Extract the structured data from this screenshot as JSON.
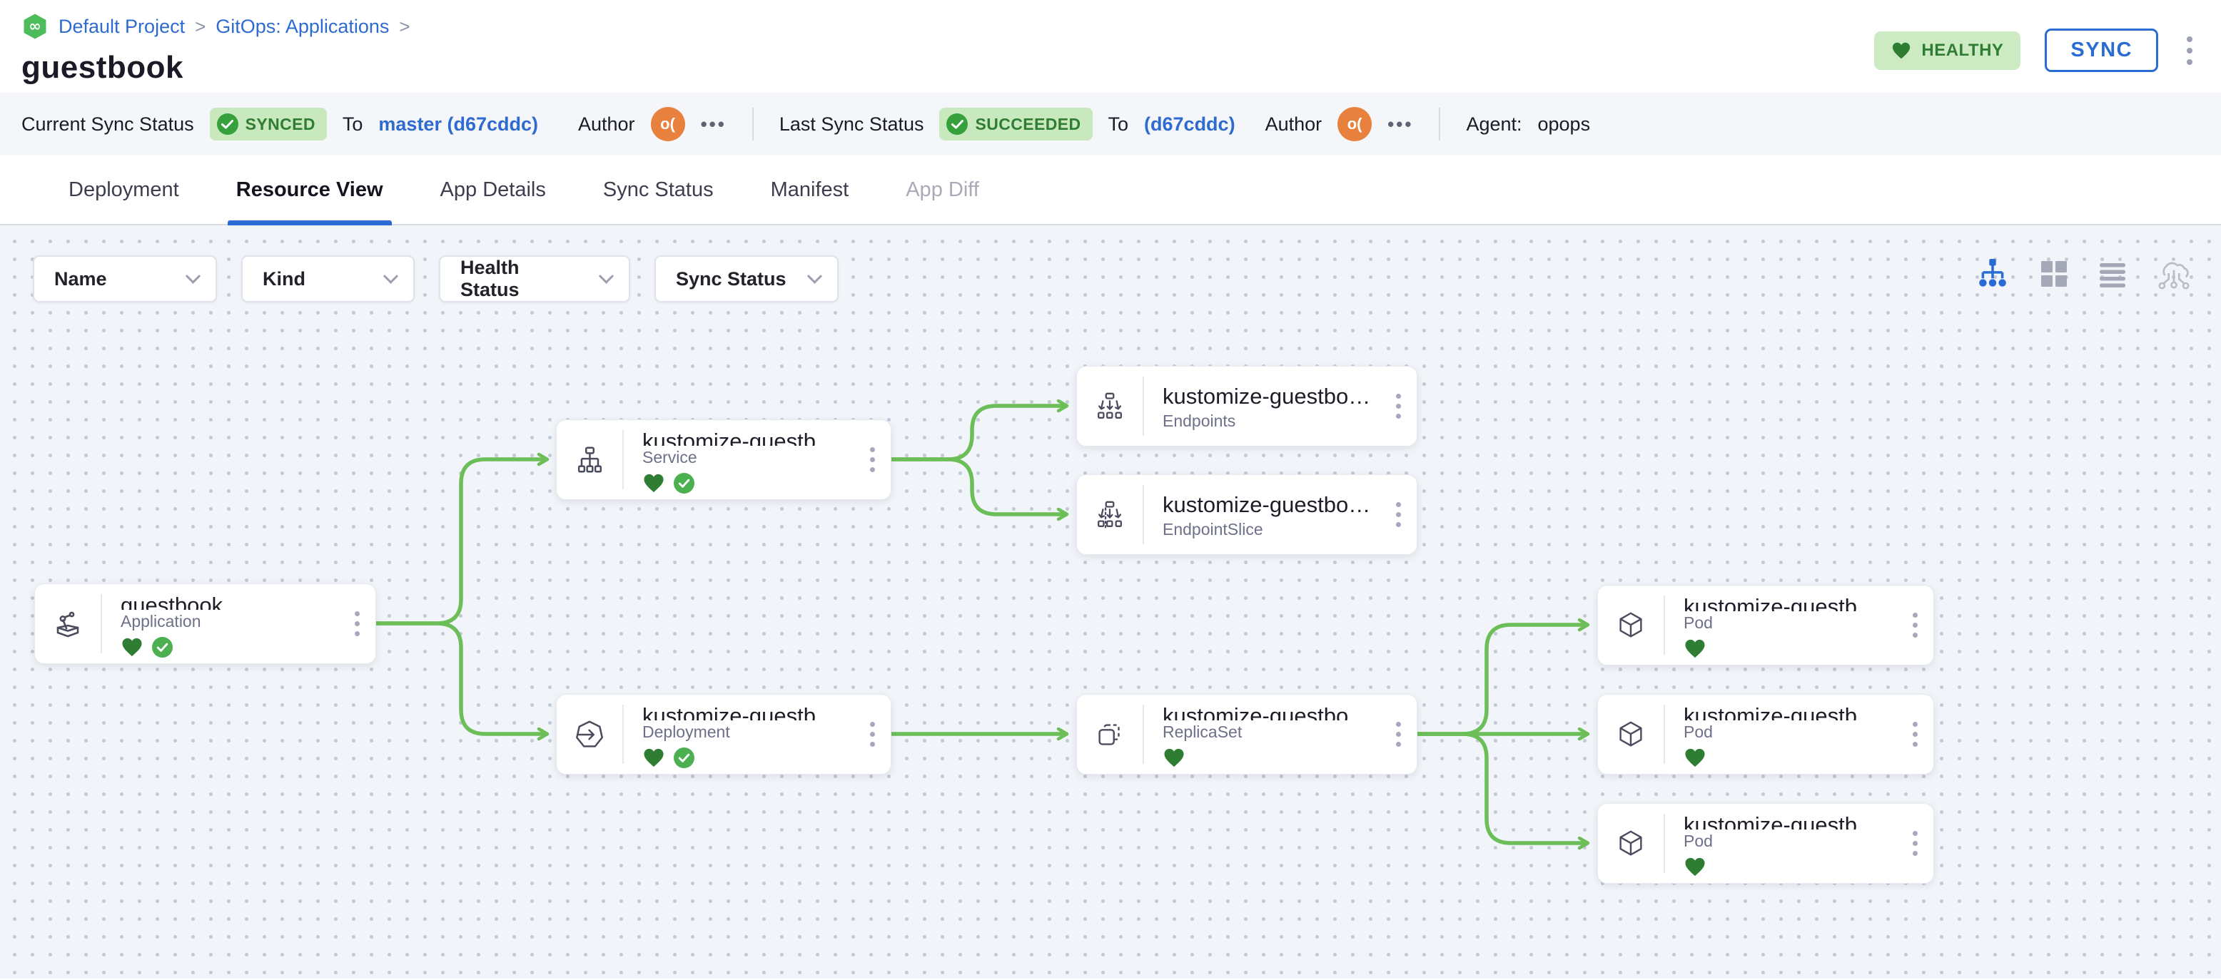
{
  "colors": {
    "accent_blue": "#2b6cd4",
    "link_blue": "#2e6bd0",
    "healthy_green": "#2e7d32",
    "badge_bg_green": "#cdebc3",
    "edge_green": "#6cbe58",
    "avatar_orange": "#e8813d",
    "canvas_bg": "#f1f5f9"
  },
  "breadcrumb": {
    "gitops_icon": "gitops-infinity-icon",
    "project": "Default Project",
    "separator": ">",
    "section": "GitOps: Applications"
  },
  "header": {
    "title": "guestbook",
    "health_badge": "HEALTHY",
    "sync_button": "SYNC"
  },
  "status_bar": {
    "current_label": "Current Sync Status",
    "current_badge": "SYNCED",
    "to_label": "To",
    "current_revision": "master (d67cddc)",
    "author_label": "Author",
    "author_initials": "o(",
    "more": "•••",
    "last_label": "Last Sync Status",
    "last_badge": "SUCCEEDED",
    "last_to_label": "To",
    "last_revision": "(d67cddc)",
    "last_author_label": "Author",
    "last_author_initials": "o(",
    "last_more": "•••",
    "agent_label": "Agent:",
    "agent_value": "opops"
  },
  "tabs": [
    {
      "label": "Deployment",
      "active": false,
      "disabled": false
    },
    {
      "label": "Resource View",
      "active": true,
      "disabled": false
    },
    {
      "label": "App Details",
      "active": false,
      "disabled": false
    },
    {
      "label": "Sync Status",
      "active": false,
      "disabled": false
    },
    {
      "label": "Manifest",
      "active": false,
      "disabled": false
    },
    {
      "label": "App Diff",
      "active": false,
      "disabled": true
    }
  ],
  "filters": [
    {
      "label": "Name"
    },
    {
      "label": "Kind"
    },
    {
      "label": "Health Status"
    },
    {
      "label": "Sync Status"
    }
  ],
  "view_toolbar": [
    {
      "icon": "tree-view-icon",
      "active": true
    },
    {
      "icon": "grid-view-icon",
      "active": false
    },
    {
      "icon": "list-view-icon",
      "active": false
    },
    {
      "icon": "cloud-view-icon",
      "active": false
    }
  ],
  "graph": {
    "nodes": [
      {
        "id": "application",
        "title": "guestbook",
        "kind": "Application",
        "healthy": true,
        "synced": true
      },
      {
        "id": "service",
        "title": "kustomize-guestbook-ui",
        "kind": "Service",
        "healthy": true,
        "synced": true
      },
      {
        "id": "deployment",
        "title": "kustomize-guestbook-ui",
        "kind": "Deployment",
        "healthy": true,
        "synced": true
      },
      {
        "id": "endpoints",
        "title": "kustomize-guestbook-ui",
        "kind": "Endpoints",
        "healthy": false,
        "synced": false
      },
      {
        "id": "endpointslice",
        "title": "kustomize-guestbook-ui-...",
        "kind": "EndpointSlice",
        "healthy": false,
        "synced": false
      },
      {
        "id": "replicaset",
        "title": "kustomize-guestbook-ui-...",
        "kind": "ReplicaSet",
        "healthy": true,
        "synced": false
      },
      {
        "id": "pod-1",
        "title": "kustomize-guestbook-ui-...",
        "kind": "Pod",
        "healthy": true,
        "synced": false
      },
      {
        "id": "pod-2",
        "title": "kustomize-guestbook-ui-...",
        "kind": "Pod",
        "healthy": true,
        "synced": false
      },
      {
        "id": "pod-3",
        "title": "kustomize-guestbook-ui-...",
        "kind": "Pod",
        "healthy": true,
        "synced": false
      }
    ],
    "edges": [
      {
        "from": "application",
        "to": "service"
      },
      {
        "from": "application",
        "to": "deployment"
      },
      {
        "from": "service",
        "to": "endpoints"
      },
      {
        "from": "service",
        "to": "endpointslice"
      },
      {
        "from": "deployment",
        "to": "replicaset"
      },
      {
        "from": "replicaset",
        "to": "pod-1"
      },
      {
        "from": "replicaset",
        "to": "pod-2"
      },
      {
        "from": "replicaset",
        "to": "pod-3"
      }
    ]
  }
}
